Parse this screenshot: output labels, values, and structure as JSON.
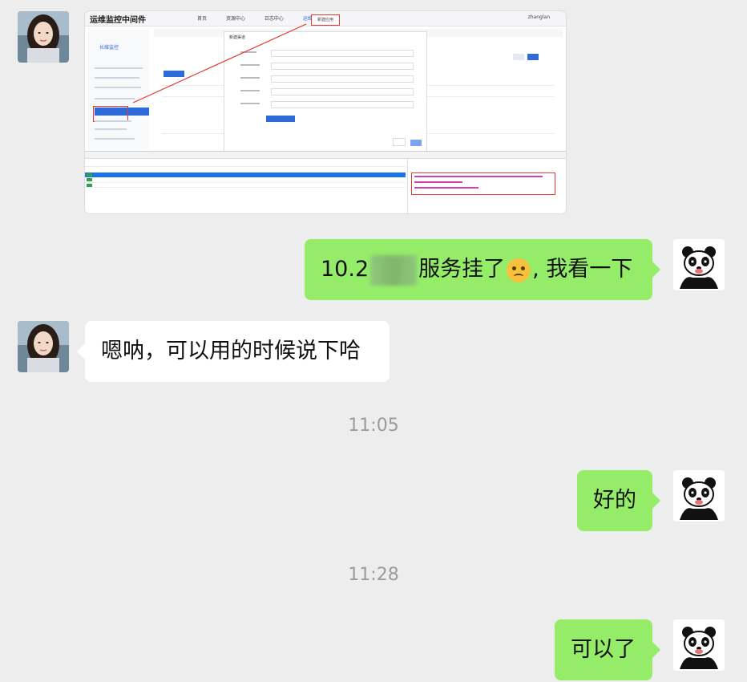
{
  "messages": [
    {
      "kind": "image",
      "side": "left",
      "screenshot": {
        "brand": "运维监控中间件",
        "nav": [
          "首页",
          "资源中心",
          "日志中心",
          "运维管理"
        ],
        "active_nav": "运维管理",
        "pill": "新建应用",
        "user": "zhanglan",
        "side_logo": "长维监控",
        "modal_title": "新建渠道"
      }
    },
    {
      "kind": "text",
      "side": "right",
      "parts": {
        "before": "10.2",
        "after": "服务挂了",
        "tail": ", 我看一下"
      }
    },
    {
      "kind": "text",
      "side": "left",
      "text": "嗯呐，可以用的时候说下哈"
    },
    {
      "kind": "time",
      "text": "11:05"
    },
    {
      "kind": "text",
      "side": "right",
      "text": "好的"
    },
    {
      "kind": "time",
      "text": "11:28"
    },
    {
      "kind": "text",
      "side": "right",
      "text": "可以了"
    }
  ],
  "colors": {
    "background": "#ededed",
    "incoming": "#ffffff",
    "outgoing": "#95ec69",
    "time": "#9b9b9b"
  },
  "icons": {
    "contact_avatar": "woman-portrait-avatar",
    "self_avatar": "panda-avatar"
  }
}
